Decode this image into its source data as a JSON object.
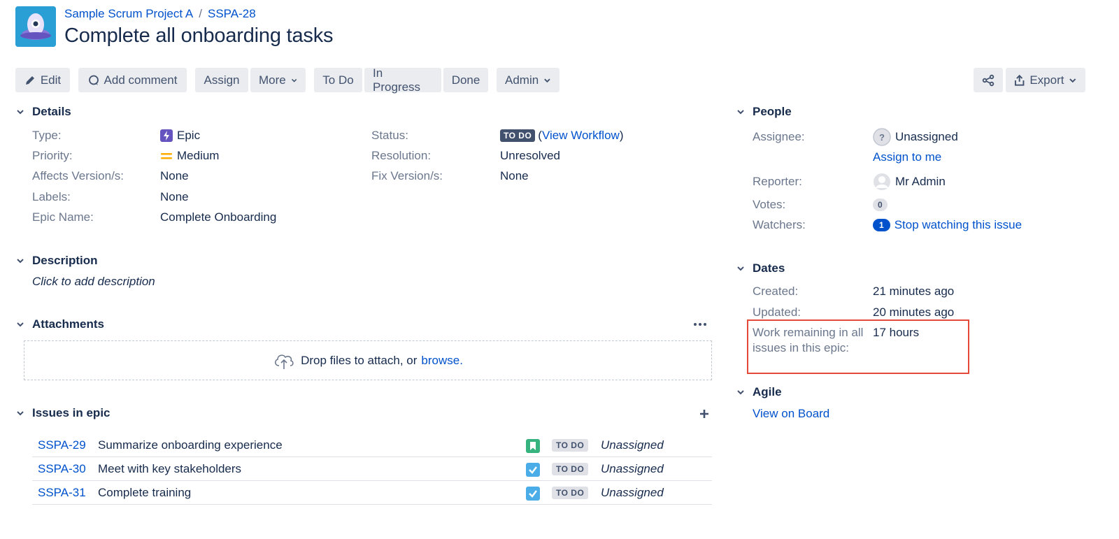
{
  "breadcrumb": {
    "project": "Sample Scrum Project A",
    "separator": "/",
    "issue_key": "SSPA-28"
  },
  "title": "Complete all onboarding tasks",
  "toolbar": {
    "edit": "Edit",
    "add_comment": "Add comment",
    "assign": "Assign",
    "more": "More",
    "to_do": "To Do",
    "in_progress": "In Progress",
    "done": "Done",
    "admin": "Admin",
    "export": "Export"
  },
  "details": {
    "heading": "Details",
    "type_label": "Type:",
    "type_value": "Epic",
    "priority_label": "Priority:",
    "priority_value": "Medium",
    "affects_label": "Affects Version/s:",
    "affects_value": "None",
    "labels_label": "Labels:",
    "labels_value": "None",
    "epic_name_label": "Epic Name:",
    "epic_name_value": "Complete Onboarding",
    "status_label": "Status:",
    "status_value": "TO DO",
    "view_workflow": "View Workflow",
    "resolution_label": "Resolution:",
    "resolution_value": "Unresolved",
    "fix_label": "Fix Version/s:",
    "fix_value": "None"
  },
  "description": {
    "heading": "Description",
    "placeholder": "Click to add description"
  },
  "attachments": {
    "heading": "Attachments",
    "drop_text": "Drop files to attach, or",
    "browse": "browse."
  },
  "issues_in_epic": {
    "heading": "Issues in epic",
    "rows": [
      {
        "key": "SSPA-29",
        "summary": "Summarize onboarding experience",
        "type": "story",
        "status": "TO DO",
        "assignee": "Unassigned"
      },
      {
        "key": "SSPA-30",
        "summary": "Meet with key stakeholders",
        "type": "task",
        "status": "TO DO",
        "assignee": "Unassigned"
      },
      {
        "key": "SSPA-31",
        "summary": "Complete training",
        "type": "task",
        "status": "TO DO",
        "assignee": "Unassigned"
      }
    ]
  },
  "people": {
    "heading": "People",
    "assignee_label": "Assignee:",
    "assignee_value": "Unassigned",
    "assign_to_me": "Assign to me",
    "reporter_label": "Reporter:",
    "reporter_value": "Mr Admin",
    "votes_label": "Votes:",
    "votes_value": "0",
    "watchers_label": "Watchers:",
    "watchers_value": "1",
    "stop_watching": "Stop watching this issue"
  },
  "dates": {
    "heading": "Dates",
    "created_label": "Created:",
    "created_value": "21 minutes ago",
    "updated_label": "Updated:",
    "updated_value": "20 minutes ago",
    "work_label_1": "Work remaining in all",
    "work_label_2": "issues in this epic:",
    "work_value": "17 hours"
  },
  "agile": {
    "heading": "Agile",
    "view_on_board": "View on Board"
  },
  "colors": {
    "link": "#0052cc",
    "highlight": "#e5493a",
    "epic": "#6554c0",
    "medium_priority": "#ffab00",
    "story": "#36b37e",
    "task": "#4bade8"
  }
}
